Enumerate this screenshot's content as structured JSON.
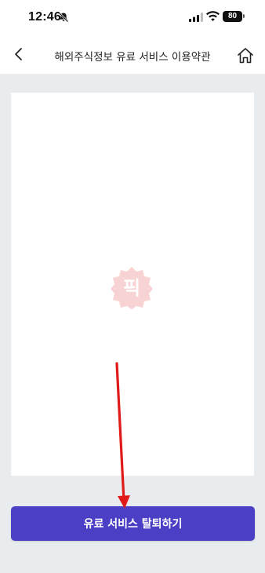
{
  "status_bar": {
    "time": "12:46",
    "battery_level": "80",
    "icons": [
      "bell-off-icon",
      "signal-icon",
      "wifi-icon",
      "battery-icon"
    ]
  },
  "nav": {
    "title": "해외주식정보 유료 서비스 이용약관",
    "back_icon": "chevron-left-icon",
    "home_icon": "home-icon"
  },
  "watermark": {
    "text": "픽"
  },
  "cta": {
    "label": "유료 서비스 탈퇴하기"
  },
  "colors": {
    "accent": "#4b3fc6",
    "background": "#e9ecee",
    "annotation": "#e01919"
  }
}
